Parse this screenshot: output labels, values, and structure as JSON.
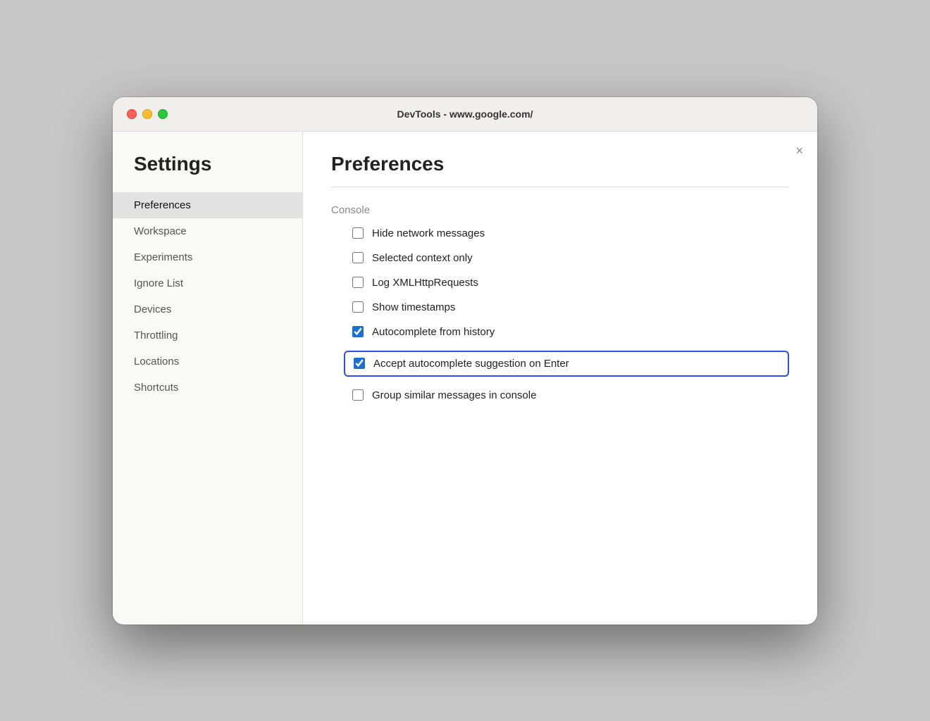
{
  "titlebar": {
    "title": "DevTools - www.google.com/"
  },
  "sidebar": {
    "heading": "Settings",
    "items": [
      {
        "id": "preferences",
        "label": "Preferences",
        "active": true
      },
      {
        "id": "workspace",
        "label": "Workspace",
        "active": false
      },
      {
        "id": "experiments",
        "label": "Experiments",
        "active": false
      },
      {
        "id": "ignore-list",
        "label": "Ignore List",
        "active": false
      },
      {
        "id": "devices",
        "label": "Devices",
        "active": false
      },
      {
        "id": "throttling",
        "label": "Throttling",
        "active": false
      },
      {
        "id": "locations",
        "label": "Locations",
        "active": false
      },
      {
        "id": "shortcuts",
        "label": "Shortcuts",
        "active": false
      }
    ]
  },
  "main": {
    "title": "Preferences",
    "close_label": "×",
    "section_label": "Console",
    "checkboxes": [
      {
        "id": "hide-network",
        "label": "Hide network messages",
        "checked": false,
        "highlighted": false
      },
      {
        "id": "selected-context",
        "label": "Selected context only",
        "checked": false,
        "highlighted": false
      },
      {
        "id": "log-xhr",
        "label": "Log XMLHttpRequests",
        "checked": false,
        "highlighted": false
      },
      {
        "id": "show-timestamps",
        "label": "Show timestamps",
        "checked": false,
        "highlighted": false
      },
      {
        "id": "autocomplete-history",
        "label": "Autocomplete from history",
        "checked": true,
        "highlighted": false
      },
      {
        "id": "accept-autocomplete",
        "label": "Accept autocomplete suggestion on Enter",
        "checked": true,
        "highlighted": true
      },
      {
        "id": "group-similar",
        "label": "Group similar messages in console",
        "checked": false,
        "highlighted": false
      }
    ]
  }
}
